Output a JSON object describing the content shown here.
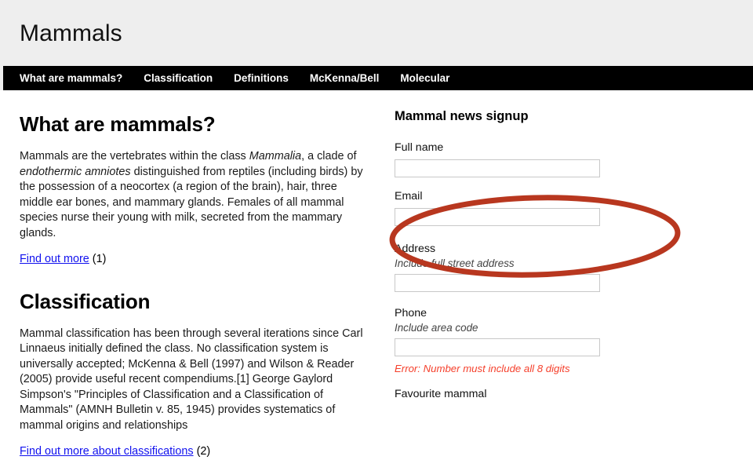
{
  "header": {
    "site_title": "Mammals"
  },
  "nav": {
    "items": [
      {
        "label": "What are mammals?"
      },
      {
        "label": "Classification"
      },
      {
        "label": "Definitions"
      },
      {
        "label": "McKenna/Bell"
      },
      {
        "label": "Molecular"
      }
    ]
  },
  "article": {
    "sections": [
      {
        "heading": "What are mammals?",
        "paragraph_part1": "Mammals are the vertebrates within the class ",
        "paragraph_em1": "Mammalia",
        "paragraph_part2": ", a clade of ",
        "paragraph_em2": "endothermic amniotes",
        "paragraph_part3": " distinguished from reptiles (including birds) by the possession of a neocortex (a region of the brain), hair, three middle ear bones, and mammary glands. Females of all mammal species nurse their young with milk, secreted from the mammary glands.",
        "link_text": "Find out more",
        "link_suffix": " (1)"
      },
      {
        "heading": "Classification",
        "paragraph": "Mammal classification has been through several iterations since Carl Linnaeus initially defined the class. No classification system is universally accepted; McKenna & Bell (1997) and Wilson & Reader (2005) provide useful recent compendiums.[1] George Gaylord Simpson's \"Principles of Classification and a Classification of Mammals\" (AMNH Bulletin v. 85, 1945) provides systematics of mammal origins and relationships",
        "link_text": "Find out more about classifications",
        "link_suffix": " (2)"
      }
    ]
  },
  "signup_form": {
    "heading": "Mammal news signup",
    "fields": {
      "full_name": {
        "label": "Full name",
        "value": "",
        "placeholder": ""
      },
      "email": {
        "label": "Email",
        "value": "",
        "placeholder": ""
      },
      "address": {
        "label": "Address",
        "hint": "Include full street address",
        "value": "",
        "placeholder": ""
      },
      "phone": {
        "label": "Phone",
        "hint": "Include area code",
        "value": "",
        "placeholder": "",
        "error": "Error: Number must include all 8 digits"
      },
      "favourite_mammal": {
        "label": "Favourite mammal"
      }
    }
  },
  "annotation": {
    "shape": "ellipse-highlight",
    "target": "email-field",
    "color": "#b8371f",
    "stroke_width": 7
  },
  "colors": {
    "header_background": "#eeeeee",
    "nav_background": "#000000",
    "nav_text": "#ffffff",
    "page_background": "#ffffff",
    "link": "#1111ee",
    "error_text": "#f5402c",
    "input_border": "#c8c8c8",
    "annotation_red": "#b8371f"
  }
}
